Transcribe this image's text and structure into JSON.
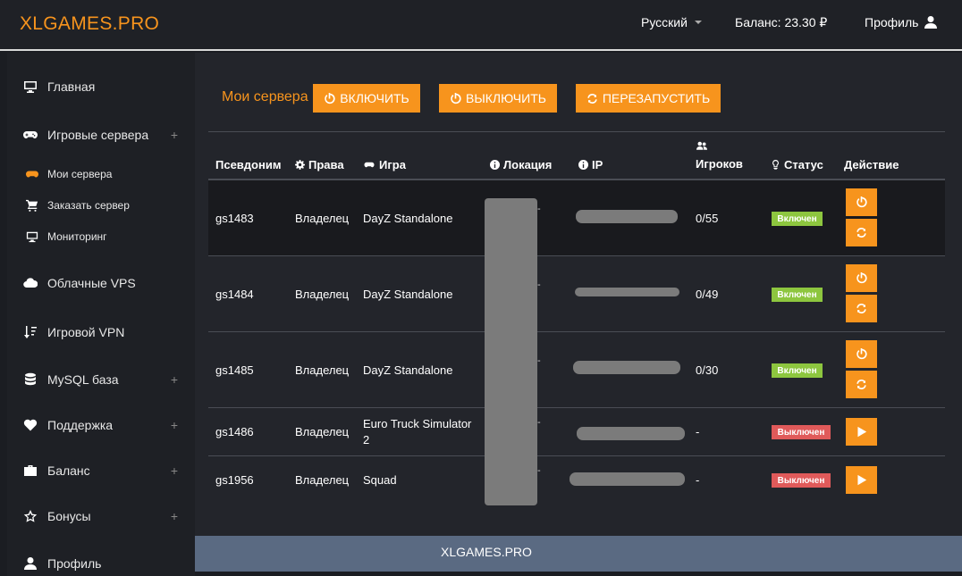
{
  "header": {
    "logo": "XLGAMES.PRO",
    "language": "Русский",
    "balance": "Баланс: 23.30 ₽",
    "profile": "Профиль"
  },
  "sidebar": {
    "items": [
      {
        "label": "Главная",
        "icon": "monitor-icon"
      },
      {
        "label": "Игровые сервера",
        "icon": "gamepad-icon",
        "expand": "+"
      },
      {
        "label": "Облачные VPS",
        "icon": "cloud-icon"
      },
      {
        "label": "Игровой VPN",
        "icon": "sort-icon"
      },
      {
        "label": "MySQL база",
        "icon": "database-icon",
        "expand": "+"
      },
      {
        "label": "Поддержка",
        "icon": "heart-icon",
        "expand": "+"
      },
      {
        "label": "Баланс",
        "icon": "briefcase-icon",
        "expand": "+"
      },
      {
        "label": "Бонусы",
        "icon": "star-icon",
        "expand": "+"
      },
      {
        "label": "Профиль",
        "icon": "user-icon"
      }
    ],
    "subitems": [
      {
        "label": "Мои сервера",
        "icon": "gamepad-icon"
      },
      {
        "label": "Заказать сервер",
        "icon": "cart-icon"
      },
      {
        "label": "Мониторинг",
        "icon": "monitor-icon"
      }
    ]
  },
  "main": {
    "title": "Мои сервера",
    "buttons": {
      "on": "ВКЛЮЧИТЬ",
      "off": "ВЫКЛЮЧИТЬ",
      "restart": "ПЕРЕЗАПУСТИТЬ"
    },
    "columns": [
      "Псевдоним",
      "Права",
      "Игра",
      "Локация",
      "IP",
      "Игроков",
      "Статус",
      "Действие"
    ],
    "rows": [
      {
        "alias": "gs1483",
        "rights": "Владелец",
        "game": "DayZ Standalone",
        "loc": "-",
        "players": "0/55",
        "status": "Включен",
        "state": "on"
      },
      {
        "alias": "gs1484",
        "rights": "Владелец",
        "game": "DayZ Standalone",
        "loc": "-",
        "players": "0/49",
        "status": "Включен",
        "state": "on"
      },
      {
        "alias": "gs1485",
        "rights": "Владелец",
        "game": "DayZ Standalone",
        "loc": "-",
        "players": "0/30",
        "status": "Включен",
        "state": "on"
      },
      {
        "alias": "gs1486",
        "rights": "Владелец",
        "game": "Euro Truck Simulator 2",
        "loc": "-",
        "players": "-",
        "status": "Выключен",
        "state": "off"
      },
      {
        "alias": "gs1956",
        "rights": "Владелец",
        "game": "Squad",
        "loc": "-",
        "players": "-",
        "status": "Выключен",
        "state": "off"
      }
    ]
  },
  "footer": {
    "text": "XLGAMES.PRO"
  },
  "colors": {
    "accent": "#f7941d",
    "on": "#8dc63f",
    "off": "#e05a5a",
    "footer": "#5a6a82"
  }
}
